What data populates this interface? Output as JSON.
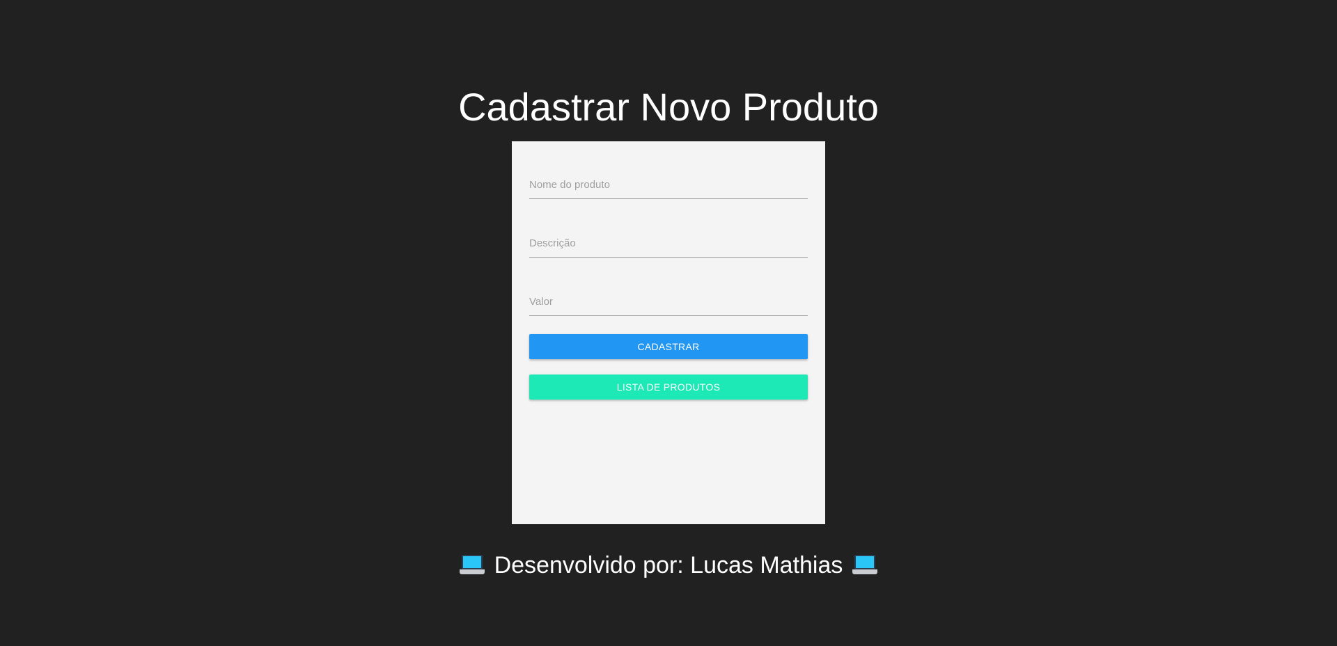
{
  "page": {
    "title": "Cadastrar Novo Produto"
  },
  "form": {
    "fields": [
      {
        "placeholder": "Nome do produto",
        "value": ""
      },
      {
        "placeholder": "Descrição",
        "value": ""
      },
      {
        "placeholder": "Valor",
        "value": ""
      }
    ],
    "submit_label": "CADASTRAR",
    "list_label": "LISTA DE PRODUTOS"
  },
  "footer": {
    "text": "Desenvolvido por: Lucas Mathias",
    "icon": "laptop-icon"
  },
  "colors": {
    "background": "#212121",
    "card": "#f4f4f4",
    "submit_button": "#2196f3",
    "list_button": "#1de9b6"
  }
}
